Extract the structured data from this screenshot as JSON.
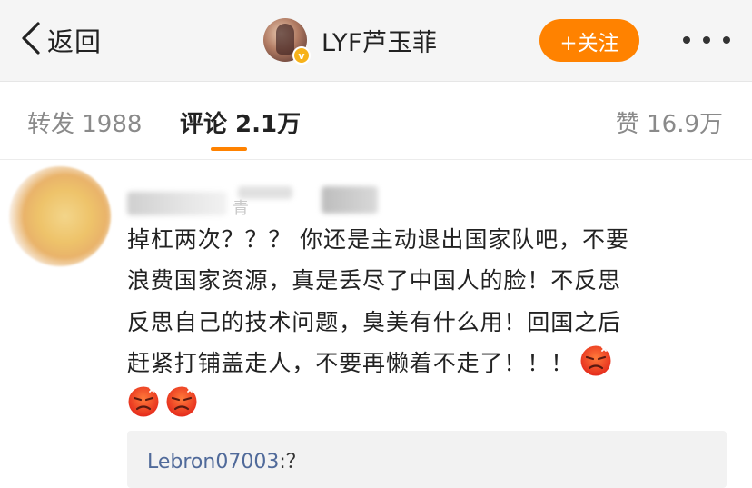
{
  "nav": {
    "back_label": "返回",
    "username": "LYF芦玉菲",
    "follow_label": "+关注"
  },
  "tabs": {
    "repost_label": "转发 1988",
    "comment_label": "评论 2.1万",
    "like_label": "赞 16.9万"
  },
  "comment": {
    "name_partial": "青",
    "lines": [
      "掉杠两次？？？ 你还是主动退出国家队吧，不要",
      "浪费国家资源，真是丢尽了中国人的脸！不反思",
      "反思自己的技术问题，臭美有什么用！回国之后",
      "赶紧打铺盖走人，不要再懒着不走了！！！"
    ],
    "emoji_name": "angry-face-emoji",
    "reply": {
      "user": "Lebron07003",
      "separator": ":",
      "text": "？"
    }
  },
  "colors": {
    "accent": "#ff8200",
    "reply_user": "#506a9a",
    "navbar_bg": "#f5f5f5",
    "reply_bg": "#f2f2f2"
  }
}
